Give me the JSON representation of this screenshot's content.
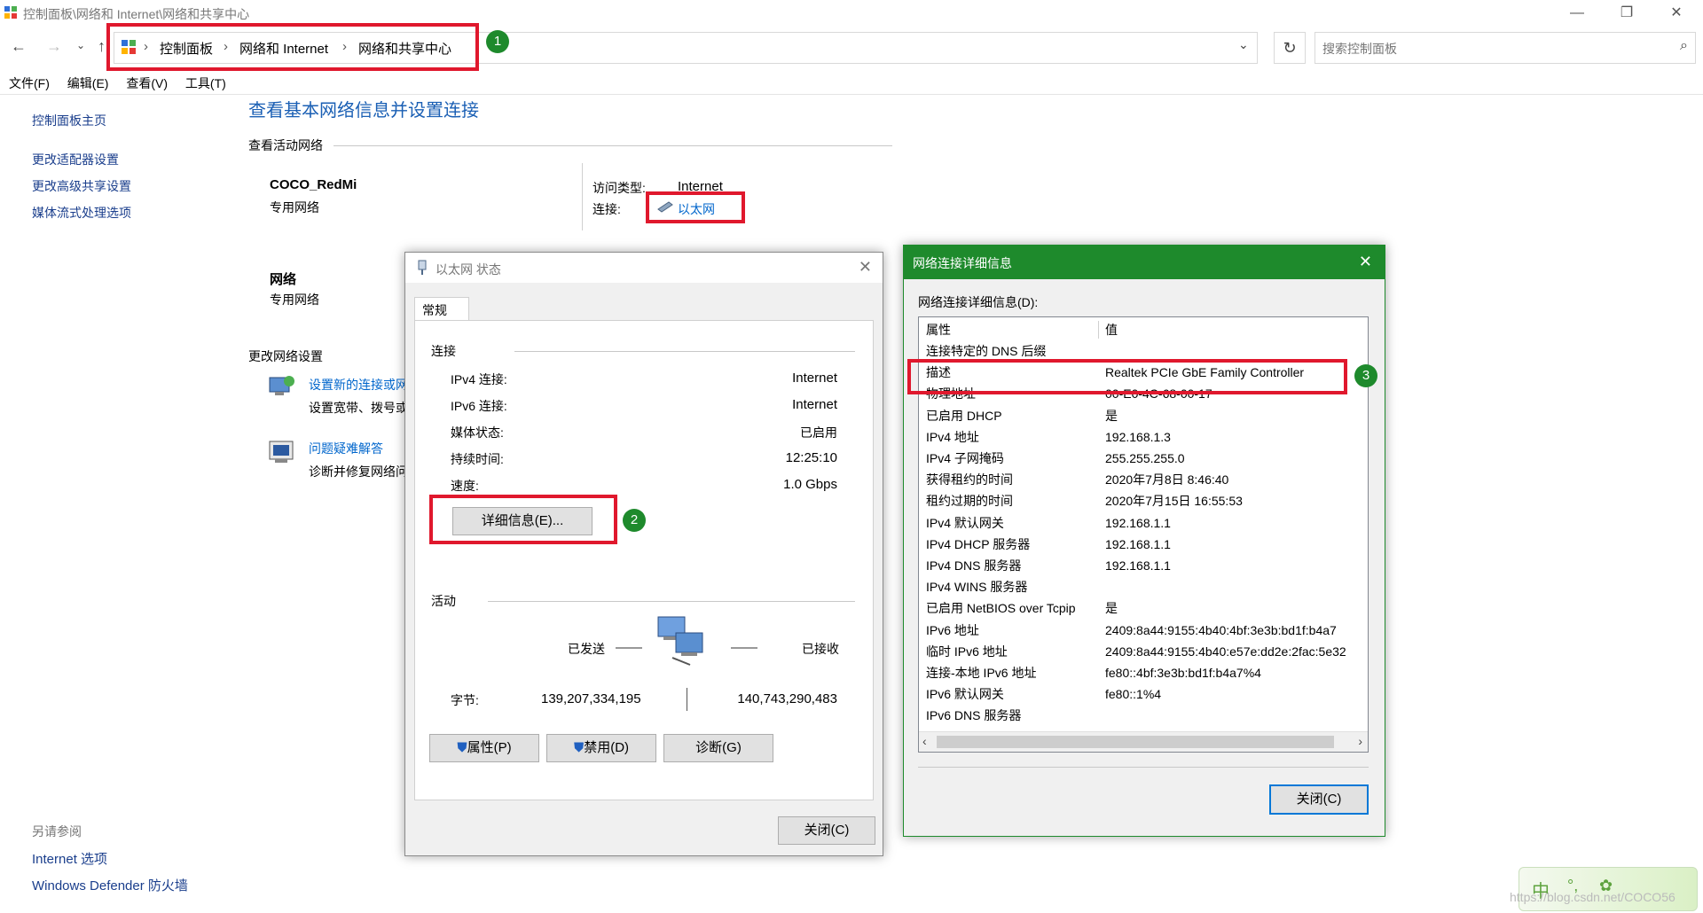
{
  "window": {
    "title": "控制面板\\网络和 Internet\\网络和共享中心",
    "minimize": "—",
    "restore": "❐",
    "close": "✕"
  },
  "address": {
    "crumbs": [
      "控制面板",
      "网络和 Internet",
      "网络和共享中心"
    ],
    "search_placeholder": "搜索控制面板"
  },
  "menu": [
    "文件(F)",
    "编辑(E)",
    "查看(V)",
    "工具(T)"
  ],
  "sidebar": {
    "home": "控制面板主页",
    "items": [
      "更改适配器设置",
      "更改高级共享设置",
      "媒体流式处理选项"
    ],
    "see_also_title": "另请参阅",
    "see_also": [
      "Internet 选项",
      "Windows Defender 防火墙"
    ]
  },
  "main": {
    "heading": "查看基本网络信息并设置连接",
    "active_title": "查看活动网络",
    "networks": [
      {
        "name": "COCO_RedMi",
        "type": "专用网络"
      },
      {
        "name": "网络",
        "type": "专用网络"
      }
    ],
    "access_label": "访问类型:",
    "access_value": "Internet",
    "conn_label": "连接:",
    "conn_value": "以太网",
    "change_title": "更改网络设置",
    "tasks": [
      {
        "link": "设置新的连接或网络",
        "desc": "设置宽带、拨号或 VPN 连接"
      },
      {
        "link": "问题疑难解答",
        "desc": "诊断并修复网络问题"
      }
    ]
  },
  "status_dialog": {
    "title": "以太网 状态",
    "tab": "常规",
    "conn_section": "连接",
    "rows": [
      {
        "label": "IPv4 连接:",
        "value": "Internet"
      },
      {
        "label": "IPv6 连接:",
        "value": "Internet"
      },
      {
        "label": "媒体状态:",
        "value": "已启用"
      },
      {
        "label": "持续时间:",
        "value": "12:25:10"
      },
      {
        "label": "速度:",
        "value": "1.0 Gbps"
      }
    ],
    "details_button": "详细信息(E)...",
    "activity_section": "活动",
    "sent_label": "已发送",
    "recv_label": "已接收",
    "bytes_label": "字节:",
    "bytes_sent": "139,207,334,195",
    "bytes_recv": "140,743,290,483",
    "buttons": [
      "属性(P)",
      "禁用(D)",
      "诊断(G)"
    ],
    "close_button": "关闭(C)"
  },
  "details_dialog": {
    "title": "网络连接详细信息",
    "caption": "网络连接详细信息(D):",
    "col_property": "属性",
    "col_value": "值",
    "rows": [
      {
        "k": "连接特定的 DNS 后缀",
        "v": ""
      },
      {
        "k": "描述",
        "v": "Realtek PCIe GbE Family Controller"
      },
      {
        "k": "物理地址",
        "v": "00-E0-4C-68-00-17"
      },
      {
        "k": "已启用 DHCP",
        "v": "是"
      },
      {
        "k": "IPv4 地址",
        "v": "192.168.1.3"
      },
      {
        "k": "IPv4 子网掩码",
        "v": "255.255.255.0"
      },
      {
        "k": "获得租约的时间",
        "v": "2020年7月8日 8:46:40"
      },
      {
        "k": "租约过期的时间",
        "v": "2020年7月15日 16:55:53"
      },
      {
        "k": "IPv4 默认网关",
        "v": "192.168.1.1"
      },
      {
        "k": "IPv4 DHCP 服务器",
        "v": "192.168.1.1"
      },
      {
        "k": "IPv4 DNS 服务器",
        "v": "192.168.1.1"
      },
      {
        "k": "IPv4 WINS 服务器",
        "v": ""
      },
      {
        "k": "已启用 NetBIOS over Tcpip",
        "v": "是"
      },
      {
        "k": "IPv6 地址",
        "v": "2409:8a44:9155:4b40:4bf:3e3b:bd1f:b4a7"
      },
      {
        "k": "临时 IPv6 地址",
        "v": "2409:8a44:9155:4b40:e57e:dd2e:2fac:5e32"
      },
      {
        "k": "连接-本地 IPv6 地址",
        "v": "fe80::4bf:3e3b:bd1f:b4a7%4"
      },
      {
        "k": "IPv6 默认网关",
        "v": "fe80::1%4"
      },
      {
        "k": "IPv6 DNS 服务器",
        "v": ""
      }
    ],
    "close_button": "关闭(C)"
  },
  "annotations": [
    "1",
    "2",
    "3"
  ],
  "watermark": {
    "ime": "中",
    "text": "https://blog.csdn.net/COCO56"
  },
  "colors": {
    "accent_link": "#0066cc",
    "details_titlebar": "#1e8a2c",
    "highlight": "#e0182d"
  }
}
